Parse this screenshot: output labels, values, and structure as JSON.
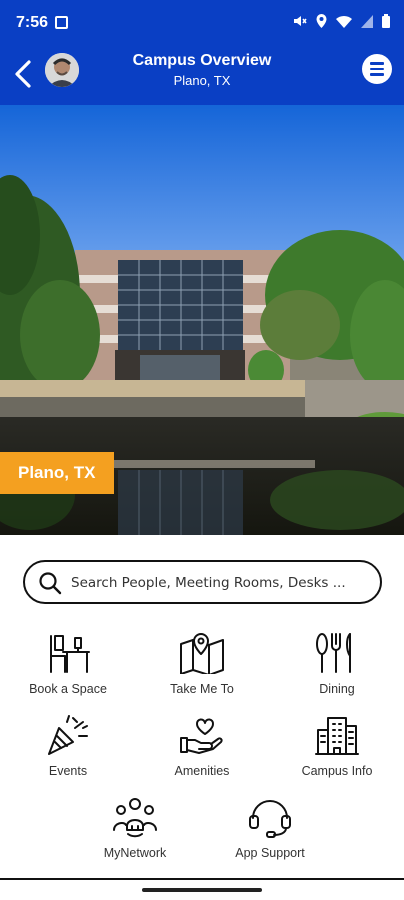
{
  "status_bar": {
    "time": "7:56"
  },
  "header": {
    "title": "Campus Overview",
    "subtitle": "Plano, TX"
  },
  "hero": {
    "location_badge": "Plano, TX",
    "badge_color": "#f4a020",
    "header_color": "#0a3fc4"
  },
  "search": {
    "placeholder": "Search People, Meeting Rooms, Desks ..."
  },
  "tiles": [
    {
      "label": "Book a Space",
      "icon": "desk-chair-icon"
    },
    {
      "label": "Take Me To",
      "icon": "map-pin-icon"
    },
    {
      "label": "Dining",
      "icon": "utensils-icon"
    },
    {
      "label": "Events",
      "icon": "party-popper-icon"
    },
    {
      "label": "Amenities",
      "icon": "heart-hand-icon"
    },
    {
      "label": "Campus Info",
      "icon": "buildings-icon"
    },
    {
      "label": "MyNetwork",
      "icon": "people-network-icon"
    },
    {
      "label": "App Support",
      "icon": "headset-icon"
    }
  ]
}
